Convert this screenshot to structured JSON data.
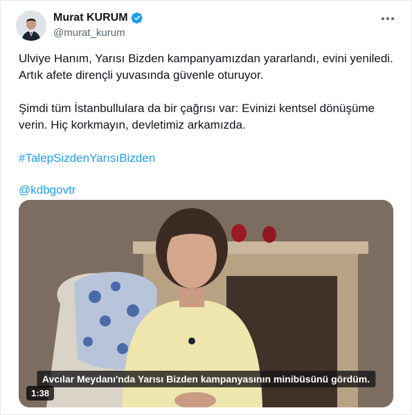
{
  "author": {
    "display_name": "Murat KURUM",
    "handle": "@murat_kurum",
    "verified": true,
    "avatar_icon": "profile-photo"
  },
  "post": {
    "paragraph_1": "Ulviye Hanım, Yarısı Bizden kampanyamızdan yararlandı, evini yeniledi. Artık afete dirençli yuvasında güvenle oturuyor.",
    "paragraph_2": "Şimdi tüm İstanbullulara da bir çağrısı var: Evinizi kentsel dönüşüme verin. Hiç korkmayın, devletimiz arkamızda.",
    "hashtag": "#TalepSizdenYarısıBizden",
    "mention": "@kdbgovtr"
  },
  "video": {
    "caption": "Avcılar Meydanı'nda Yarısı Bizden kampanyasının minibüsünü gördüm.",
    "duration": "1:38"
  },
  "colors": {
    "link": "#1d9bf0",
    "verified_badge": "#1d9bf0",
    "secondary_text": "#536471"
  },
  "icons": {
    "more": "more-horizontal-icon",
    "verified": "verified-badge-icon"
  }
}
